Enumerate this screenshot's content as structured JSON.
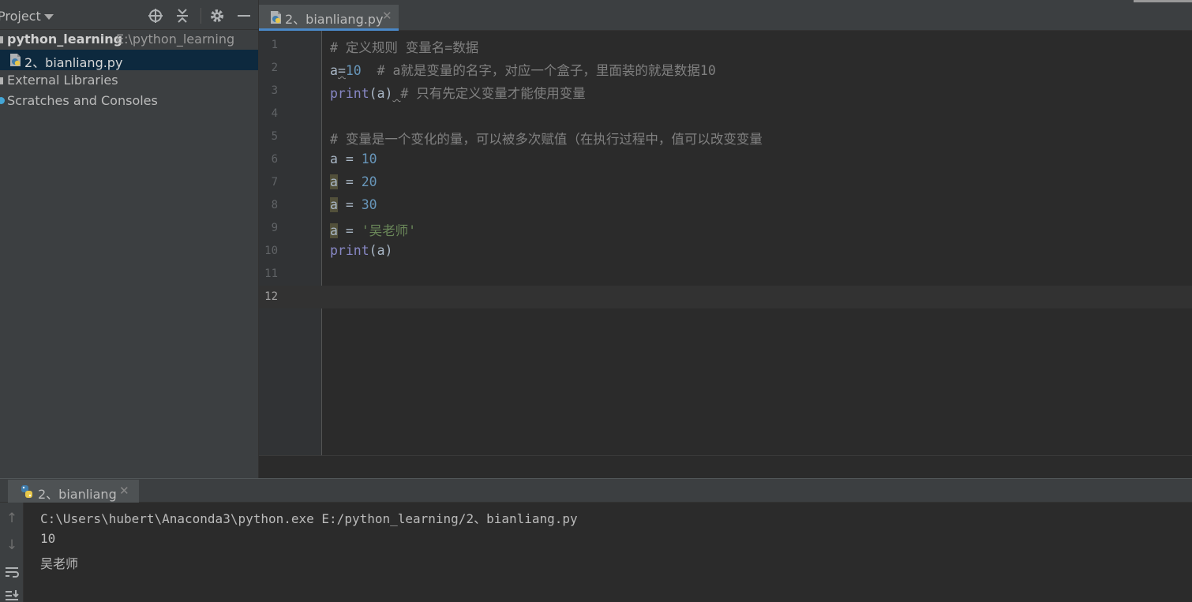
{
  "project_panel": {
    "title": "Project",
    "tree": [
      {
        "name": "python_learning",
        "path": "E:\\python_learning"
      },
      {
        "name": "2、bianliang.py"
      },
      {
        "name": "External Libraries"
      },
      {
        "name": "Scratches and Consoles"
      }
    ]
  },
  "editor": {
    "tab_label": "2、bianliang.py",
    "lines": [
      {
        "num": "1",
        "t": [
          {
            "c": "# 定义规则 变量名=数据",
            "k": "cmt"
          }
        ]
      },
      {
        "num": "2",
        "t": [
          {
            "c": "a",
            "k": "p"
          },
          {
            "c": "=",
            "k": "squig"
          },
          {
            "c": "10",
            "k": "num"
          },
          {
            "c": "  # a就是变量的名字，对应一个盒子，里面装的就是数据10",
            "k": "cmt"
          }
        ]
      },
      {
        "num": "3",
        "t": [
          {
            "c": "print",
            "k": "kw"
          },
          {
            "c": "(a)",
            "k": "p"
          },
          {
            "c": " ",
            "k": "squig"
          },
          {
            "c": "# 只有先定义变量才能使用变量",
            "k": "cmt"
          }
        ]
      },
      {
        "num": "4",
        "t": []
      },
      {
        "num": "5",
        "t": [
          {
            "c": "# 变量是一个变化的量，可以被多次赋值（在执行过程中，值可以改变变量",
            "k": "cmt"
          }
        ]
      },
      {
        "num": "6",
        "t": [
          {
            "c": "a",
            "k": "p"
          },
          {
            "c": " = ",
            "k": "p"
          },
          {
            "c": "10",
            "k": "num"
          }
        ]
      },
      {
        "num": "7",
        "t": [
          {
            "c": "a",
            "k": "hl"
          },
          {
            "c": " = ",
            "k": "p"
          },
          {
            "c": "20",
            "k": "num"
          }
        ]
      },
      {
        "num": "8",
        "t": [
          {
            "c": "a",
            "k": "hl"
          },
          {
            "c": " = ",
            "k": "p"
          },
          {
            "c": "30",
            "k": "num"
          }
        ]
      },
      {
        "num": "9",
        "t": [
          {
            "c": "a",
            "k": "hl"
          },
          {
            "c": " = ",
            "k": "p"
          },
          {
            "c": "'吴老师'",
            "k": "str"
          }
        ]
      },
      {
        "num": "10",
        "t": [
          {
            "c": "print",
            "k": "kw"
          },
          {
            "c": "(a)",
            "k": "p"
          }
        ]
      },
      {
        "num": "11",
        "t": []
      },
      {
        "num": "12",
        "t": [],
        "current": true
      }
    ]
  },
  "run_panel": {
    "tab_label": "2、bianliang",
    "output": [
      "C:\\Users\\hubert\\Anaconda3\\python.exe E:/python_learning/2、bianliang.py",
      "10",
      "吴老师"
    ]
  },
  "colors": {
    "background": "#2b2b2b",
    "panel": "#3c3f41",
    "selection": "#0d293e",
    "comment": "#808080",
    "number": "#6897bb",
    "keyword": "#8888c6",
    "string": "#6a8759"
  },
  "icons": [
    "chevron-down-icon",
    "crosshair-icon",
    "collapse-icon",
    "gear-icon",
    "minimize-icon",
    "python-file-icon",
    "close-icon",
    "arrow-up-icon",
    "arrow-down-icon",
    "soft-wrap-icon",
    "scroll-to-end-icon"
  ]
}
